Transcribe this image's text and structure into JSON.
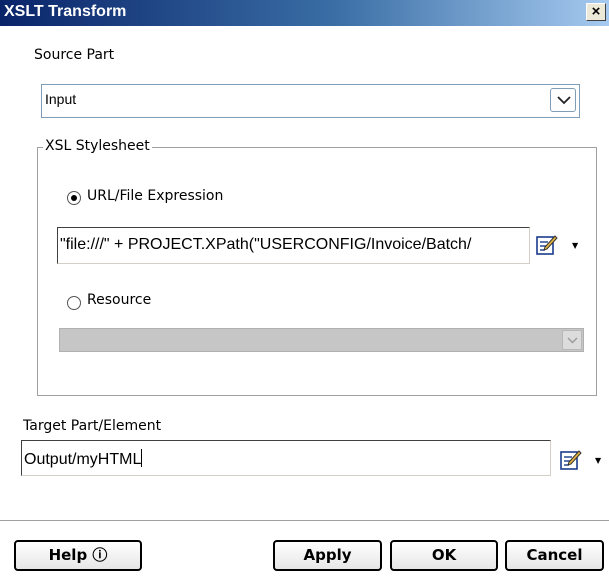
{
  "window": {
    "title": "XSLT Transform",
    "close_glyph": "×"
  },
  "source_part": {
    "label": "Source Part",
    "value": "Input"
  },
  "xsl_stylesheet": {
    "group_label": "XSL Stylesheet",
    "url_option": {
      "label": "URL/File Expression",
      "selected": true
    },
    "expression_value": "\"file:///\" + PROJECT.XPath(\"USERCONFIG/Invoice/Batch/",
    "resource_option": {
      "label": "Resource",
      "selected": false
    },
    "resource_value": ""
  },
  "target_part": {
    "label": "Target Part/Element",
    "value": "Output/myHTML"
  },
  "buttons": {
    "help": "Help ⓘ",
    "apply": "Apply",
    "ok": "OK",
    "cancel": "Cancel"
  },
  "icons": {
    "close": "close-icon",
    "dropdown": "chevron-down-icon",
    "expression_editor": "edit-expression-icon",
    "menu_arrow": "triangle-down-icon"
  }
}
